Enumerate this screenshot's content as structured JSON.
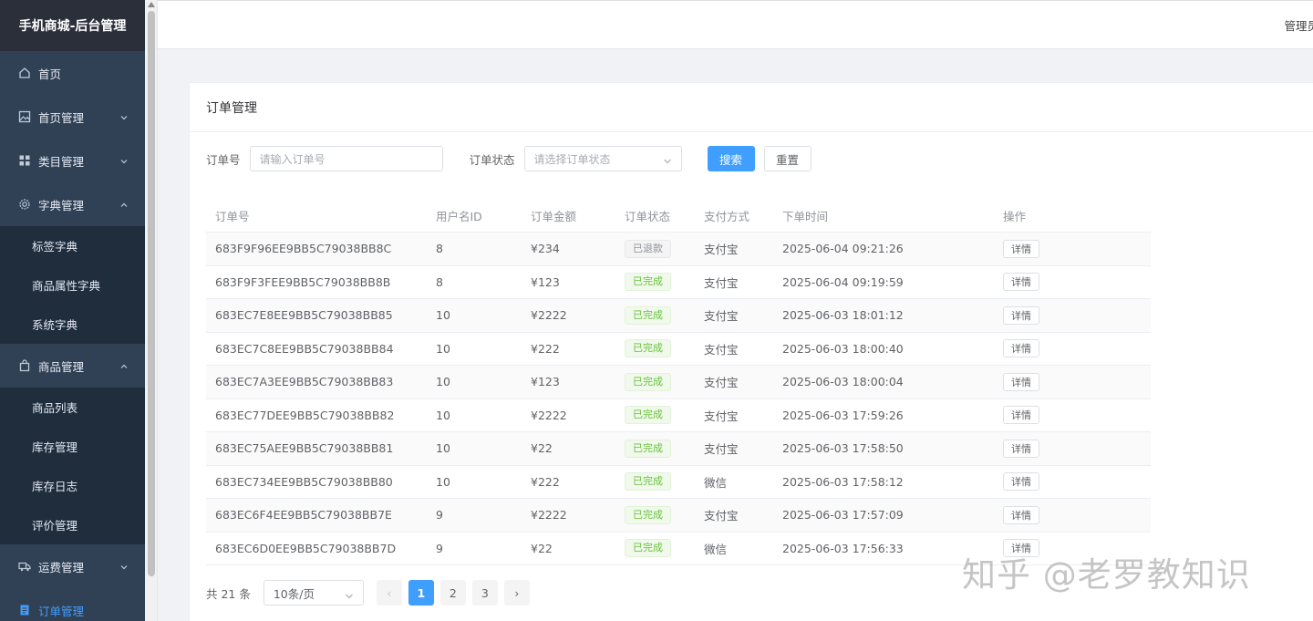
{
  "sidebar": {
    "brand": "手机商城-后台管理",
    "items": [
      {
        "label": "首页"
      },
      {
        "label": "首页管理"
      },
      {
        "label": "类目管理"
      },
      {
        "label": "字典管理"
      },
      {
        "label": "标签字典"
      },
      {
        "label": "商品属性字典"
      },
      {
        "label": "系统字典"
      },
      {
        "label": "商品管理"
      },
      {
        "label": "商品列表"
      },
      {
        "label": "库存管理"
      },
      {
        "label": "库存日志"
      },
      {
        "label": "评价管理"
      },
      {
        "label": "运费管理"
      },
      {
        "label": "订单管理"
      }
    ]
  },
  "header": {
    "user": "管理员"
  },
  "card": {
    "title": "订单管理"
  },
  "search": {
    "order_no_label": "订单号",
    "order_no_placeholder": "请输入订单号",
    "status_label": "订单状态",
    "status_placeholder": "请选择订单状态",
    "search_btn": "搜索",
    "reset_btn": "重置"
  },
  "table": {
    "headers": [
      "订单号",
      "用户名ID",
      "订单金额",
      "订单状态",
      "支付方式",
      "下单时间",
      "操作"
    ],
    "detail_label": "详情",
    "rows": [
      {
        "order": "683F9F96EE9BB5C79038BB8C",
        "uid": "8",
        "amount": "¥234",
        "status": "已退款",
        "pay": "支付宝",
        "time": "2025-06-04 09:21:26"
      },
      {
        "order": "683F9F3FEE9BB5C79038BB8B",
        "uid": "8",
        "amount": "¥123",
        "status": "已完成",
        "pay": "支付宝",
        "time": "2025-06-04 09:19:59"
      },
      {
        "order": "683EC7E8EE9BB5C79038BB85",
        "uid": "10",
        "amount": "¥2222",
        "status": "已完成",
        "pay": "支付宝",
        "time": "2025-06-03 18:01:12"
      },
      {
        "order": "683EC7C8EE9BB5C79038BB84",
        "uid": "10",
        "amount": "¥222",
        "status": "已完成",
        "pay": "支付宝",
        "time": "2025-06-03 18:00:40"
      },
      {
        "order": "683EC7A3EE9BB5C79038BB83",
        "uid": "10",
        "amount": "¥123",
        "status": "已完成",
        "pay": "支付宝",
        "time": "2025-06-03 18:00:04"
      },
      {
        "order": "683EC77DEE9BB5C79038BB82",
        "uid": "10",
        "amount": "¥2222",
        "status": "已完成",
        "pay": "支付宝",
        "time": "2025-06-03 17:59:26"
      },
      {
        "order": "683EC75AEE9BB5C79038BB81",
        "uid": "10",
        "amount": "¥22",
        "status": "已完成",
        "pay": "支付宝",
        "time": "2025-06-03 17:58:50"
      },
      {
        "order": "683EC734EE9BB5C79038BB80",
        "uid": "10",
        "amount": "¥222",
        "status": "已完成",
        "pay": "微信",
        "time": "2025-06-03 17:58:12"
      },
      {
        "order": "683EC6F4EE9BB5C79038BB7E",
        "uid": "9",
        "amount": "¥2222",
        "status": "已完成",
        "pay": "支付宝",
        "time": "2025-06-03 17:57:09"
      },
      {
        "order": "683EC6D0EE9BB5C79038BB7D",
        "uid": "9",
        "amount": "¥22",
        "status": "已完成",
        "pay": "微信",
        "time": "2025-06-03 17:56:33"
      }
    ]
  },
  "pagination": {
    "total": "共 21 条",
    "page_size": "10条/页",
    "pages": [
      "1",
      "2",
      "3"
    ],
    "prev": "‹",
    "next": "›"
  },
  "watermark": "知乎 @老罗教知识"
}
